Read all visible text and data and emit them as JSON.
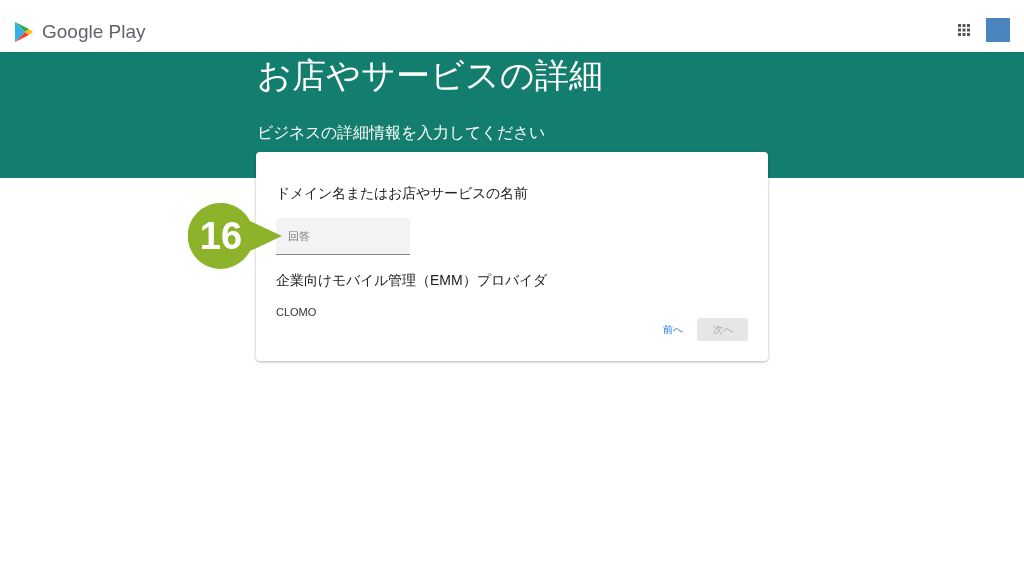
{
  "header": {
    "logo_text": "Google Play"
  },
  "banner": {
    "title": "お店やサービスの詳細",
    "subtitle": "ビジネスの詳細情報を入力してください"
  },
  "form": {
    "fields": [
      {
        "kind": "input",
        "label": "ドメイン名またはお店やサービスの名前",
        "placeholder": "回答"
      },
      {
        "kind": "static",
        "label": "企業向けモバイル管理（EMM）プロバイダ",
        "value": "CLOMO"
      }
    ],
    "buttons": [
      {
        "kind": "link",
        "label": "前へ",
        "disabled": false
      },
      {
        "kind": "button",
        "label": "次へ",
        "disabled": true
      }
    ]
  },
  "callout": {
    "number": "16"
  }
}
